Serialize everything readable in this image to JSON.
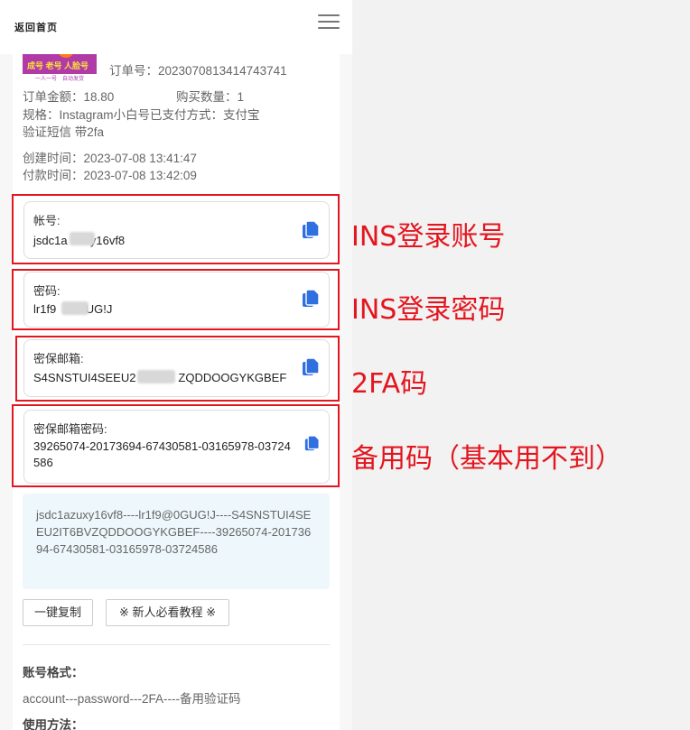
{
  "header": {
    "back_label": "返回首页"
  },
  "thumbnail": {
    "line1": "成号 老号 人脸号",
    "line2": "一人一号　自动发货"
  },
  "order": {
    "order_no": "订单号：2023070813414743741",
    "amount": "订单金额：18.80",
    "quantity": "购买数量：1",
    "spec": "规格：Instagram小白号已支付方式：支付宝",
    "spec_cont": "验证短信 带2fa",
    "created": "创建时间：2023-07-08 13:41:47",
    "paid": "付款时间：2023-07-08 13:42:09"
  },
  "fields": [
    {
      "label": "帐号:",
      "value": "jsdc1a       y16vf8"
    },
    {
      "label": "密码:",
      "value": "lr1f9         UG!J"
    },
    {
      "label": "密保邮箱:",
      "value": "S4SNSTUI4SEEU2             ZQDDOOGYKGBEF"
    },
    {
      "label": "密保邮箱密码:",
      "value": "39265074-20173694-67430581-03165978-03724586"
    }
  ],
  "annotations": [
    "INS登录账号",
    "INS登录密码",
    "2FA码",
    "备用码（基本用不到）"
  ],
  "combined": "jsdc1azuxy16vf8----lr1f9@0GUG!J----S4SNSTUI4SEEU2IT6BVZQDDOOGYKGBEF----39265074-20173694-67430581-03165978-03724586",
  "buttons": {
    "copy_all": "一键复制",
    "tutorial": "※ 新人必看教程 ※"
  },
  "format": {
    "title": "账号格式：",
    "text": "account---password---2FA----备用验证码"
  },
  "usage": {
    "title": "使用方法："
  },
  "colors": {
    "highlight": "#e3161f",
    "copy_icon": "#2f6fe0",
    "combo_bg": "#eef8fc"
  },
  "icons": [
    "hamburger-menu-icon",
    "copy-icon"
  ]
}
